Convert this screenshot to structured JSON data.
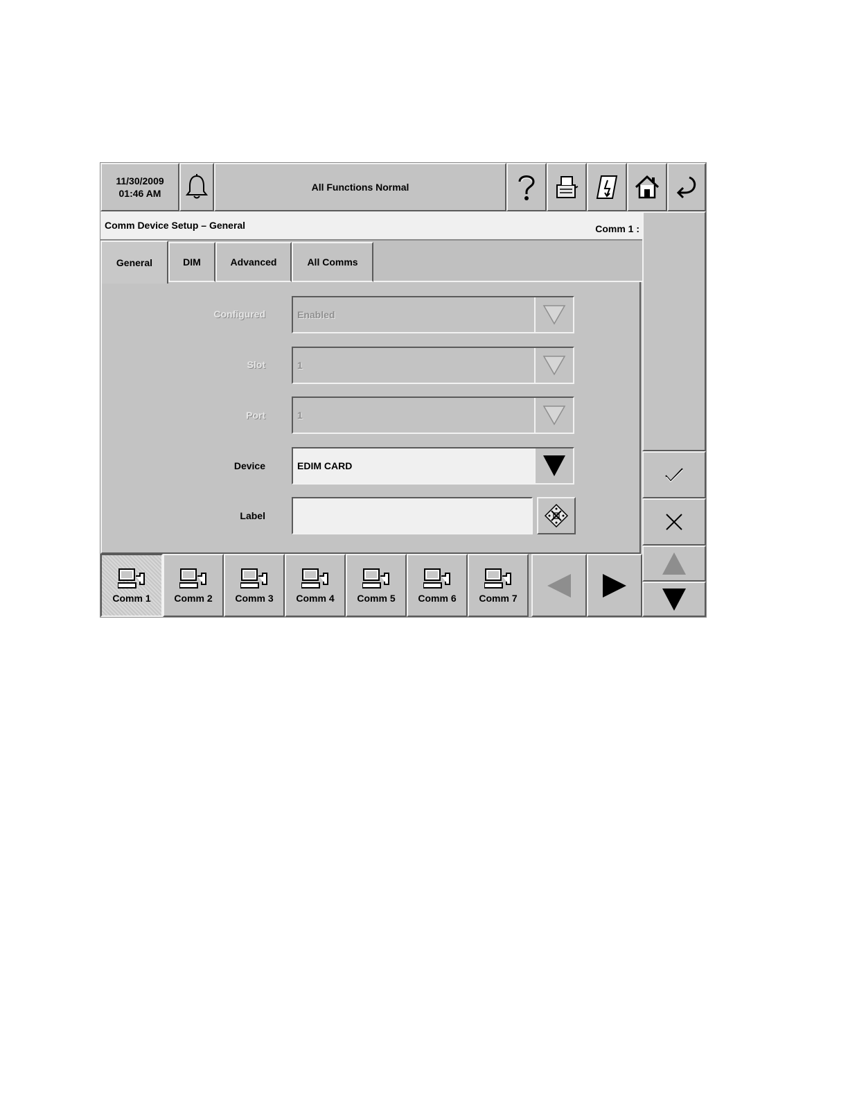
{
  "header": {
    "date": "11/30/2009",
    "time": "01:46 AM",
    "status": "All Functions Normal",
    "icons": [
      "bell-icon",
      "help-icon",
      "printer-icon",
      "report-icon",
      "home-icon",
      "back-icon"
    ]
  },
  "title": {
    "left": "Comm Device Setup – General",
    "right": "Comm 1 :"
  },
  "tabs": [
    {
      "label": "General",
      "active": true
    },
    {
      "label": "DIM"
    },
    {
      "label": "Advanced"
    },
    {
      "label": "All Comms"
    }
  ],
  "form": {
    "configured": {
      "label": "Configured",
      "value": "Enabled"
    },
    "slot": {
      "label": "Slot",
      "value": "1"
    },
    "port": {
      "label": "Port",
      "value": "1"
    },
    "device": {
      "label": "Device",
      "value": "EDIM CARD"
    },
    "label_field": {
      "label": "Label",
      "value": ""
    }
  },
  "comms": [
    {
      "label": "Comm 1",
      "active": true
    },
    {
      "label": "Comm 2"
    },
    {
      "label": "Comm 3"
    },
    {
      "label": "Comm 4"
    },
    {
      "label": "Comm 5"
    },
    {
      "label": "Comm 6"
    },
    {
      "label": "Comm 7"
    }
  ],
  "side": {
    "icons": [
      "checkmark-icon",
      "close-icon",
      "arrow-up-icon",
      "arrow-down-icon",
      "arrow-left-icon",
      "arrow-right-icon"
    ]
  }
}
